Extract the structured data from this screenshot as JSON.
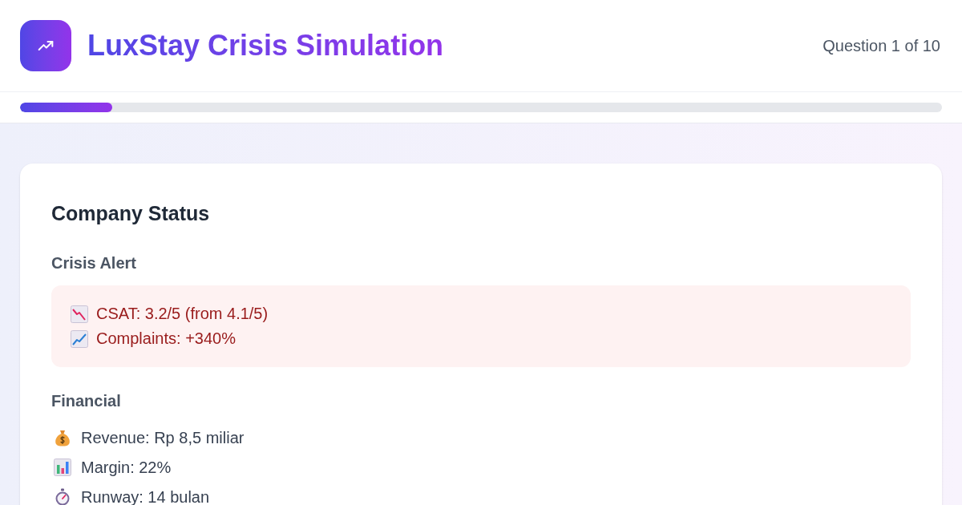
{
  "header": {
    "title": "LuxStay Crisis Simulation",
    "progress_label": "Question 1 of 10"
  },
  "progress": {
    "level": 0.1
  },
  "card": {
    "title": "Company Status",
    "sections": [
      {
        "kind": "alert",
        "heading": "Crisis Alert",
        "items": [
          "CSAT: 3.2/5 (from 4.1/5)",
          "Complaints: +340%"
        ]
      },
      {
        "kind": "list",
        "heading": "Financial",
        "items": [
          "Revenue: Rp 8,5 miliar",
          "Margin: 22%",
          "Runway: 14 bulan"
        ]
      }
    ]
  }
}
